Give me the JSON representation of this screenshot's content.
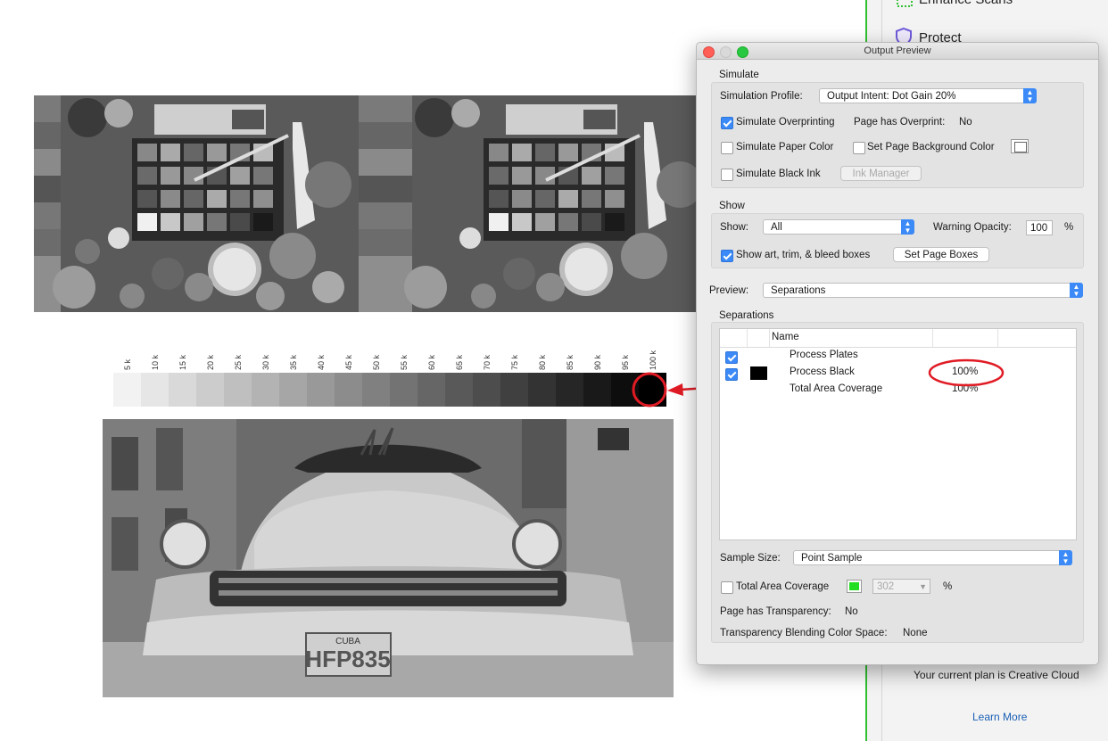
{
  "background_panel": {
    "tools": [
      {
        "label": "Enhance Scans",
        "icon": "enhance-scans-icon",
        "color": "#31c031"
      },
      {
        "label": "Protect",
        "icon": "shield-icon",
        "color": "#6e5ad8"
      }
    ],
    "plan_text": "Your current plan is Creative Cloud",
    "learn_more": "Learn More"
  },
  "ramp": {
    "labels": [
      "5 k",
      "10 k",
      "15 k",
      "20 k",
      "25 k",
      "30 k",
      "35 k",
      "40 k",
      "45 k",
      "50 k",
      "55 k",
      "60 k",
      "65 k",
      "70 k",
      "75 k",
      "80 k",
      "85 k",
      "90 k",
      "95 k",
      "100 k"
    ],
    "values": [
      5,
      10,
      15,
      20,
      25,
      30,
      35,
      40,
      45,
      50,
      55,
      60,
      65,
      70,
      75,
      80,
      85,
      90,
      95,
      100
    ]
  },
  "plate": {
    "text": "CUBA",
    "number": "HFP835"
  },
  "dialog": {
    "title": "Output Preview",
    "simulate": {
      "section": "Simulate",
      "profile_label": "Simulation Profile:",
      "profile_value": "Output Intent: Dot Gain 20%",
      "overprinting_label": "Simulate Overprinting",
      "overprinting_checked": true,
      "page_overprint_label": "Page has Overprint:",
      "page_overprint_value": "No",
      "paper_color_label": "Simulate Paper Color",
      "page_bg_label": "Set Page Background Color",
      "black_ink_label": "Simulate Black Ink",
      "ink_manager": "Ink Manager"
    },
    "show": {
      "section": "Show",
      "show_label": "Show:",
      "show_value": "All",
      "warning_label": "Warning Opacity:",
      "warning_value": "100",
      "percent": "%",
      "boxes_label": "Show art, trim, & bleed boxes",
      "boxes_checked": true,
      "set_page_boxes": "Set Page Boxes"
    },
    "preview_label": "Preview:",
    "preview_value": "Separations",
    "separations": {
      "section": "Separations",
      "col_name": "Name",
      "rows": [
        {
          "name": "Process Plates",
          "value": "",
          "checked": true,
          "swatch": ""
        },
        {
          "name": "Process Black",
          "value": "100%",
          "checked": true,
          "swatch": "#000000"
        },
        {
          "name": "Total Area Coverage",
          "value": "100%",
          "checked": false,
          "swatch": ""
        }
      ]
    },
    "sample_size_label": "Sample Size:",
    "sample_size_value": "Point Sample",
    "tac_label": "Total Area Coverage",
    "tac_value": "302",
    "tac_percent": "%",
    "tac_color": "#22dd22",
    "transparency_label": "Page has Transparency:",
    "transparency_value": "No",
    "blend_label": "Transparency Blending Color Space:",
    "blend_value": "None"
  },
  "annotation_color": "#e01b24"
}
